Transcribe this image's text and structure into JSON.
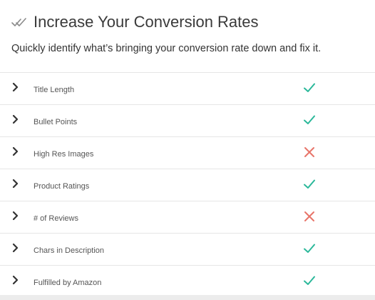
{
  "header": {
    "title": "Increase Your Conversion Rates",
    "title_icon": "double-check-icon",
    "subtitle": "Quickly identify what’s bringing your conversion rate down and fix it."
  },
  "checklist": {
    "items": [
      {
        "label": "Title Length",
        "status": "pass",
        "icon": "check-icon"
      },
      {
        "label": "Bullet Points",
        "status": "pass",
        "icon": "check-icon"
      },
      {
        "label": "High Res Images",
        "status": "fail",
        "icon": "cross-icon"
      },
      {
        "label": "Product Ratings",
        "status": "pass",
        "icon": "check-icon"
      },
      {
        "label": "# of Reviews",
        "status": "fail",
        "icon": "cross-icon"
      },
      {
        "label": "Chars in Description",
        "status": "pass",
        "icon": "check-icon"
      },
      {
        "label": "Fulfilled by Amazon",
        "status": "pass",
        "icon": "check-icon"
      }
    ]
  },
  "colors": {
    "pass": "#2bb89a",
    "fail": "#e8756a",
    "chevron": "#333333",
    "title_icon": "#888888"
  }
}
